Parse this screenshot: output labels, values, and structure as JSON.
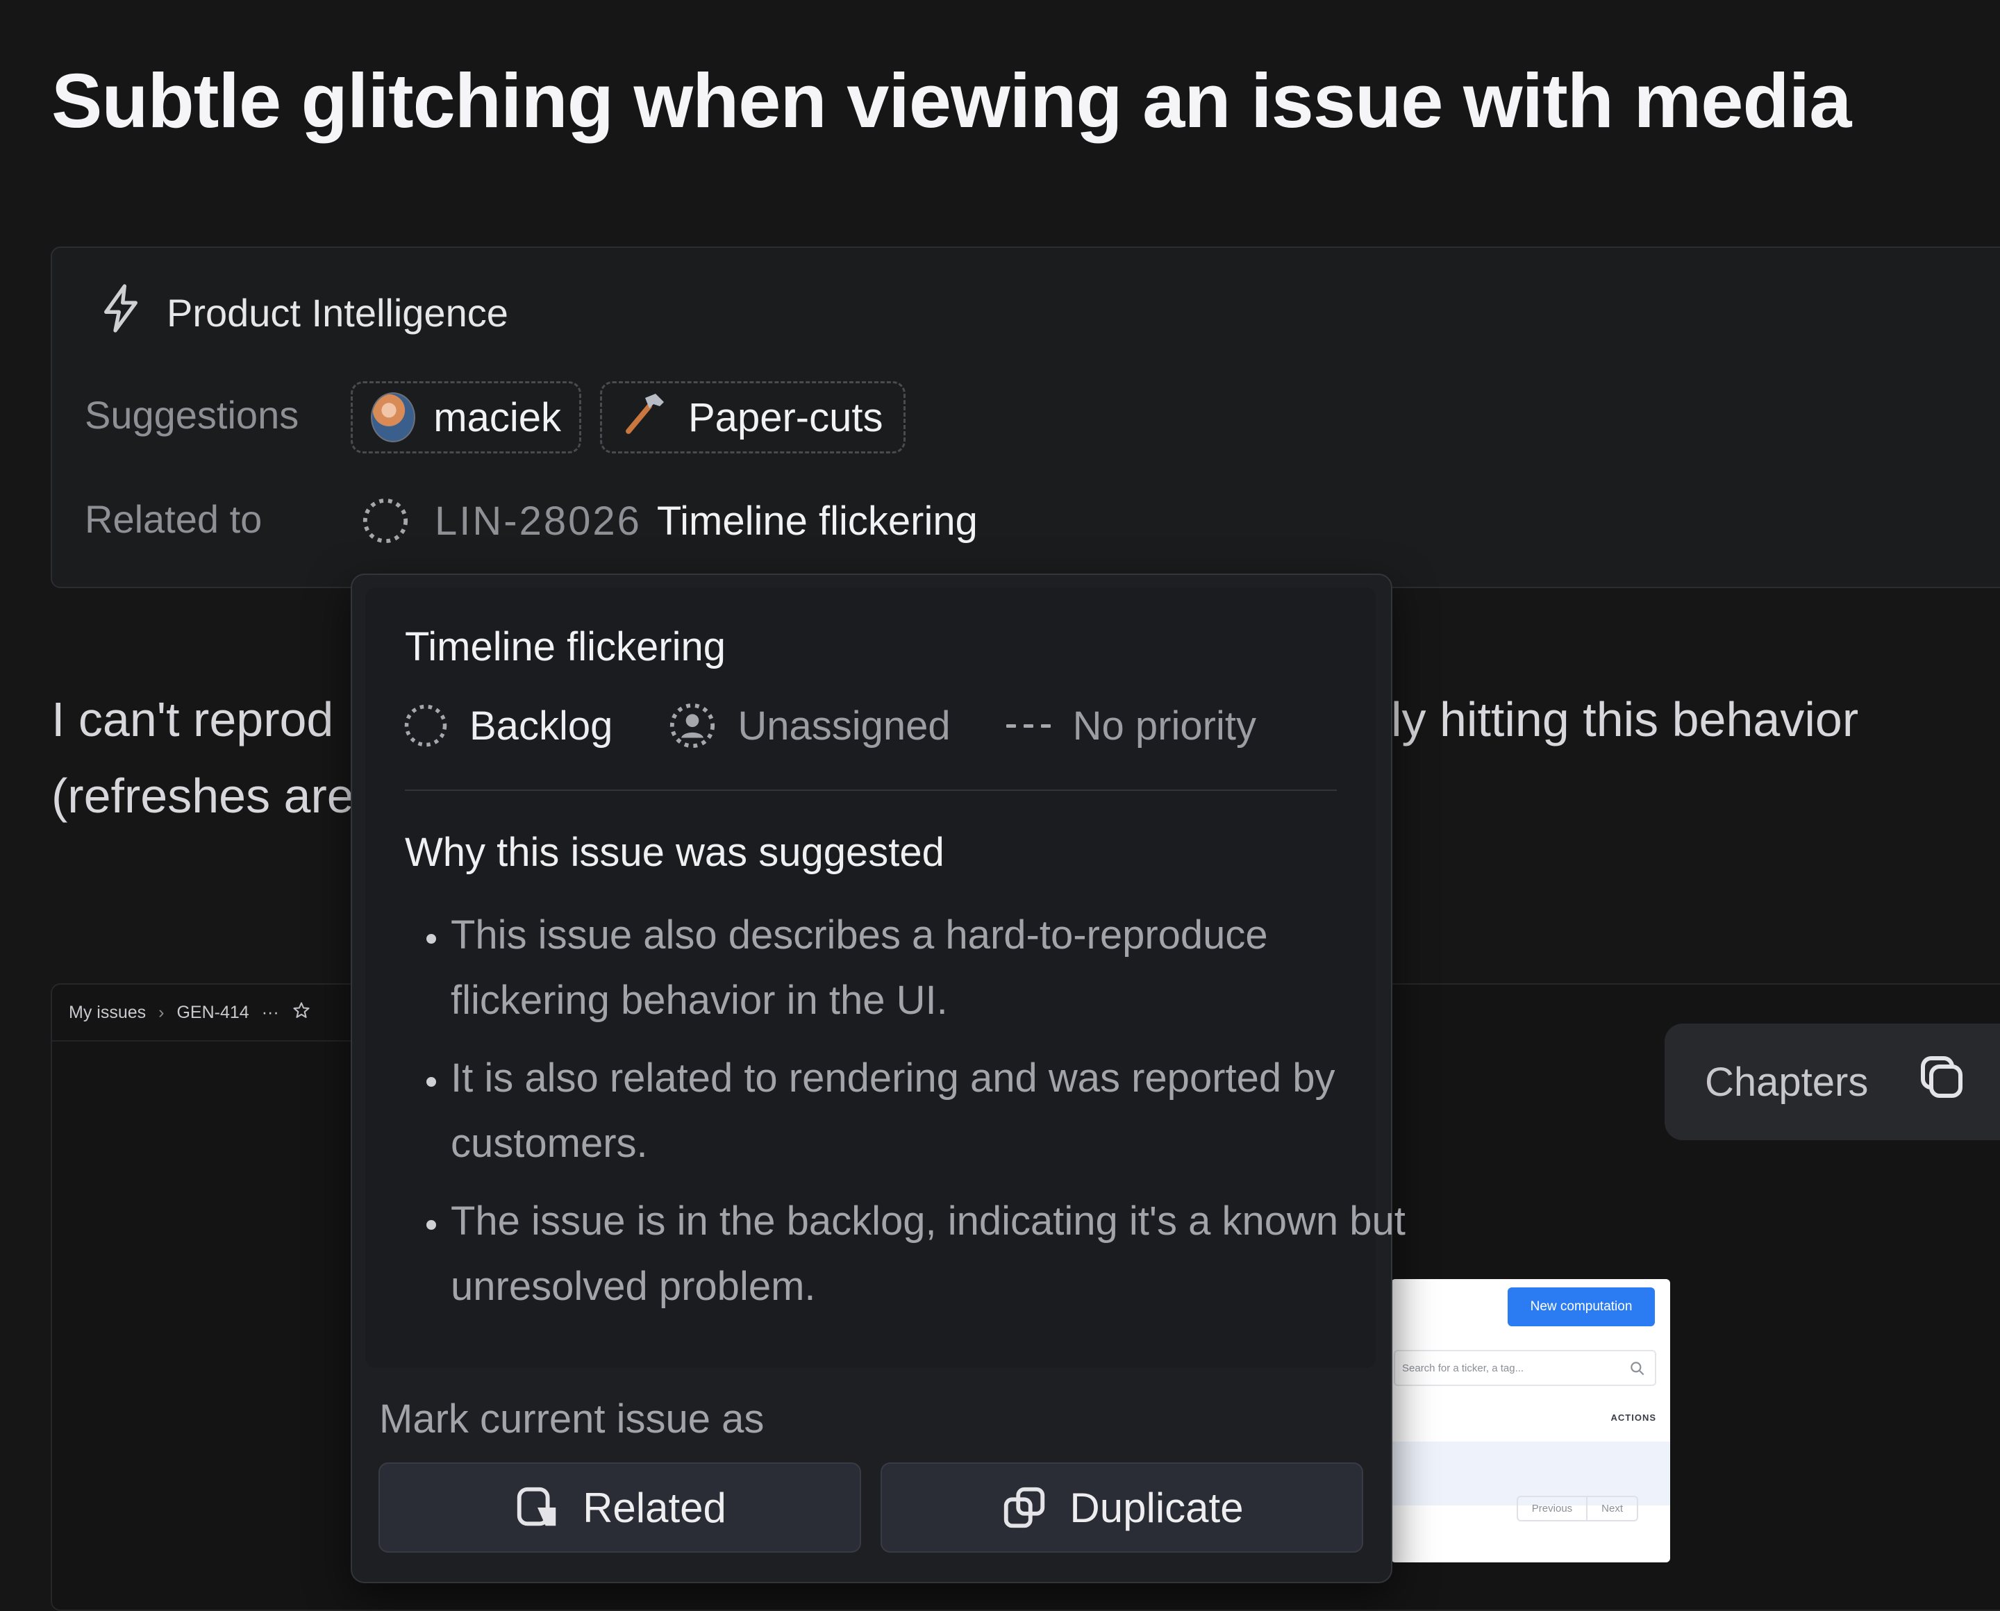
{
  "issue": {
    "title": "Subtle glitching when viewing an issue with media",
    "description_line1_left": "I can't reprod",
    "description_line1_right": "ly hitting this behavior",
    "description_line2_left": "(refreshes are"
  },
  "product_intelligence": {
    "header": "Product Intelligence",
    "suggestions_label": "Suggestions",
    "suggestion_assignee": "maciek",
    "suggestion_label": "Paper-cuts",
    "related_label": "Related to",
    "related_issue_id": "LIN-28026",
    "related_issue_title": "Timeline flickering"
  },
  "popover": {
    "title": "Timeline flickering",
    "status": "Backlog",
    "assignee": "Unassigned",
    "priority": "No priority",
    "why_heading": "Why this issue was suggested",
    "reasons": [
      "This issue also describes a hard-to-reproduce flickering behavior in the UI.",
      "It is also related to rendering and was reported by customers.",
      "The issue is in the backlog, indicating it's a known but unresolved problem."
    ],
    "mark_label": "Mark current issue as",
    "related_button": "Related",
    "duplicate_button": "Duplicate"
  },
  "embed": {
    "breadcrumb_root": "My issues",
    "breadcrumb_issue": "GEN-414",
    "more": "···",
    "chapters_label": "Chapters",
    "thumb_button": "New computation",
    "thumb_search_placeholder": "Search for a ticker, a tag...",
    "thumb_actions_header": "ACTIONS",
    "thumb_prev": "Previous",
    "thumb_next": "Next"
  },
  "icons": {
    "product_intelligence": "lightning-icon",
    "paper_cuts": "hammer-icon",
    "status": "backlog-circle-icon",
    "assignee": "unassigned-user-icon",
    "priority": "no-priority-icon",
    "related": "related-icon",
    "duplicate": "duplicate-icon",
    "chapters": "copy-stack-icon",
    "star": "star-icon"
  }
}
